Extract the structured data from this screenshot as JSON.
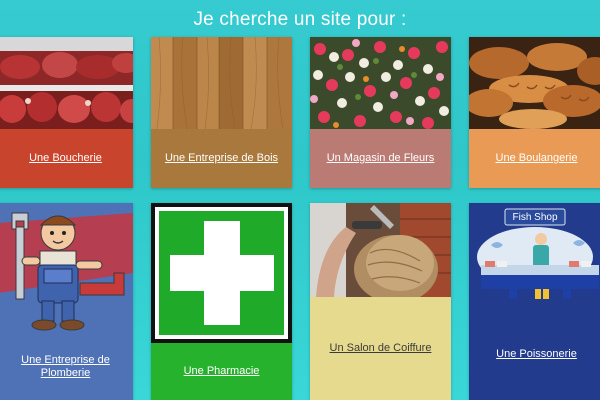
{
  "heading": "Je cherche un site pour :",
  "cards": [
    {
      "label": "Une Boucherie",
      "image": "meat-display",
      "bg": "#c9442d",
      "text_color": "#ffffff"
    },
    {
      "label": "Une Entreprise de Bois",
      "image": "wood-planks",
      "bg": "#a8783c",
      "text_color": "#ffffff"
    },
    {
      "label": "Un Magasin de Fleurs",
      "image": "flower-bouquets",
      "bg": "#b97b74",
      "text_color": "#ffffff"
    },
    {
      "label": "Une Boulangerie",
      "image": "bread-loaves",
      "bg": "#e99a55",
      "text_color": "#ffffff"
    },
    {
      "label": "Une Entreprise de Plomberie",
      "image": "plumber-cartoon",
      "bg": "#4f71b5",
      "text_color": "#ffffff"
    },
    {
      "label": "Une Pharmacie",
      "image": "green-cross",
      "bg": "#27b22d",
      "text_color": "#ffffff"
    },
    {
      "label": "Un Salon de Coiffure",
      "image": "hairdresser-photo",
      "bg": "#e6da8f",
      "text_color": "#3b3b3b"
    },
    {
      "label": "Une Poissonerie",
      "image": "fish-shop",
      "bg": "#233b8c",
      "text_color": "#ffffff",
      "sign": "Fish Shop"
    }
  ]
}
